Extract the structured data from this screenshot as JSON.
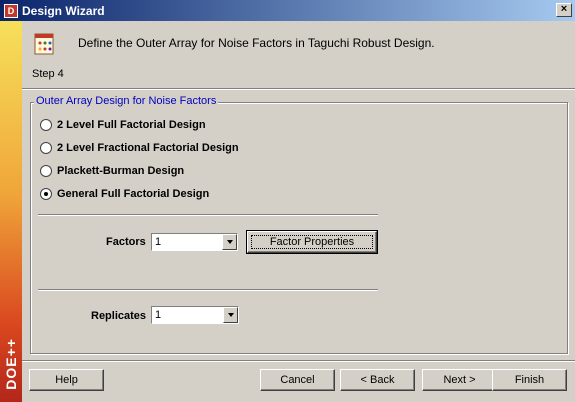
{
  "window": {
    "title": "Design Wizard",
    "app_icon_text": "D",
    "close_label": "×"
  },
  "brand": {
    "text": "DOE++"
  },
  "header": {
    "description": "Define the Outer Array for Noise Factors in Taguchi Robust Design.",
    "step": "Step 4"
  },
  "group": {
    "title": "Outer Array Design for Noise Factors",
    "options": [
      {
        "label": "2 Level Full Factorial Design",
        "checked": false
      },
      {
        "label": "2 Level Fractional Factorial Design",
        "checked": false
      },
      {
        "label": "Plackett-Burman Design",
        "checked": false
      },
      {
        "label": "General Full Factorial Design",
        "checked": true
      }
    ],
    "factors_label": "Factors",
    "factors_value": "1",
    "factor_properties_label": "Factor Properties",
    "replicates_label": "Replicates",
    "replicates_value": "1"
  },
  "footer": {
    "help": "Help",
    "cancel": "Cancel",
    "back": "< Back",
    "next": "Next >",
    "finish": "Finish"
  },
  "colors": {
    "titlebar_start": "#0a246a",
    "titlebar_end": "#a6caf0",
    "group_title": "#0000c0",
    "window_bg": "#d4d0c8"
  }
}
